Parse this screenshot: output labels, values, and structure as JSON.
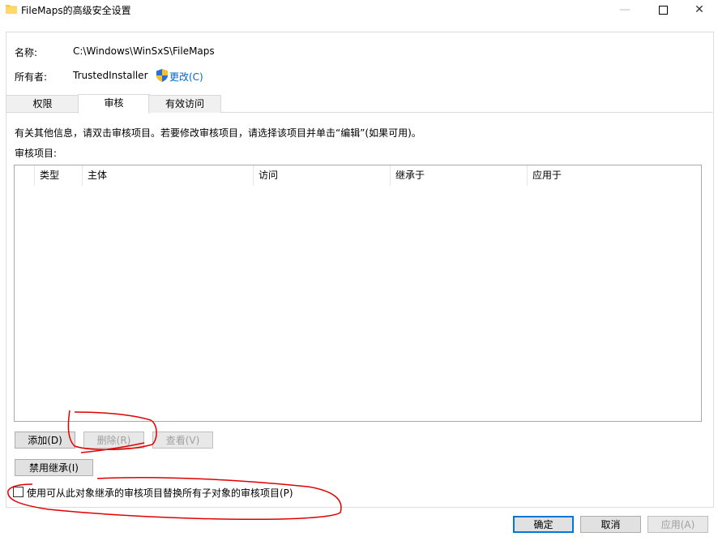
{
  "window": {
    "title": "FileMaps的高级安全设置",
    "min_glyph": "—",
    "close_glyph": "✕"
  },
  "object": {
    "name_label": "名称:",
    "name_value": "C:\\Windows\\WinSxS\\FileMaps",
    "owner_label": "所有者:",
    "owner_value": "TrustedInstaller",
    "change_link": "更改(C)"
  },
  "tabs": [
    {
      "label": "权限",
      "active": false
    },
    {
      "label": "审核",
      "active": true
    },
    {
      "label": "有效访问",
      "active": false
    }
  ],
  "audit": {
    "info_text": "有关其他信息，请双击审核项目。若要修改审核项目，请选择该项目并单击“编辑”(如果可用)。",
    "entries_label": "审核项目:",
    "columns": [
      "类型",
      "主体",
      "访问",
      "继承于",
      "应用于"
    ],
    "rows": []
  },
  "buttons": {
    "add": "添加(D)",
    "remove": "删除(R)",
    "view": "查看(V)",
    "disable_inheritance": "禁用继承(I)"
  },
  "checkbox": {
    "label": "使用可从此对象继承的审核项目替换所有子对象的审核项目(P)",
    "checked": false
  },
  "footer": {
    "ok": "确定",
    "cancel": "取消",
    "apply": "应用(A)"
  },
  "colors": {
    "link": "#0066cc",
    "annotation": "#e00000",
    "default_button_border": "#0078d7"
  }
}
